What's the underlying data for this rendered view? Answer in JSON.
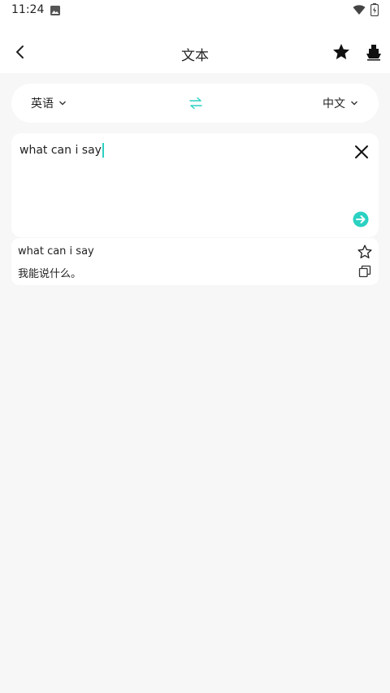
{
  "status_bar": {
    "time": "11:24",
    "icons": [
      "photo-icon",
      "wifi-icon",
      "battery-icon"
    ]
  },
  "header": {
    "title": "文本",
    "icons": [
      "back-chevron-icon",
      "star-filled-icon",
      "ship-icon"
    ]
  },
  "language_bar": {
    "source_language": "英语",
    "target_language": "中文",
    "swap_icon": "swap-arrows-icon"
  },
  "input": {
    "value": "what can i say",
    "icons": [
      "close-icon",
      "arrow-right-circle-icon"
    ]
  },
  "result": {
    "source_text": "what can i say",
    "translated_text": "我能说什么。",
    "icons": [
      "star-outline-icon",
      "copy-icon"
    ]
  },
  "colors": {
    "accent": "#2bd1c2",
    "background": "#f7f7f7",
    "card": "#ffffff",
    "text": "#222222"
  }
}
